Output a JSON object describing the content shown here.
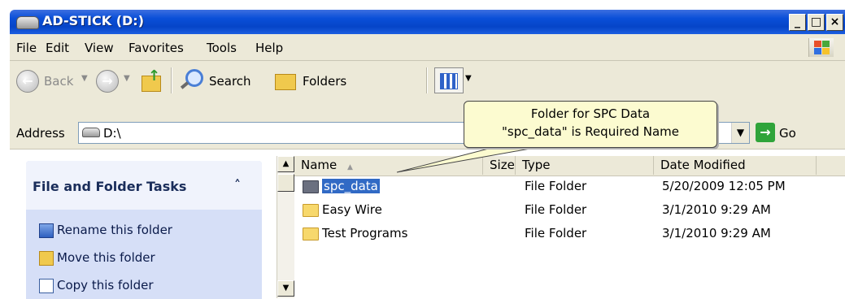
{
  "window": {
    "title": "AD-STICK (D:)",
    "controls": {
      "minimize": "_",
      "maximize": "□",
      "close": "×"
    }
  },
  "menubar": {
    "items": [
      "File",
      "Edit",
      "View",
      "Favorites",
      "Tools",
      "Help"
    ]
  },
  "toolbar": {
    "back_label": "Back",
    "search_label": "Search",
    "folders_label": "Folders"
  },
  "address": {
    "label": "Address",
    "value": "D:\\",
    "go_label": "Go"
  },
  "tasks_panel": {
    "title": "File and Folder Tasks",
    "collapse_glyph": "˄",
    "items": [
      {
        "label": "Rename this folder",
        "icon": "rename-icon"
      },
      {
        "label": "Move this folder",
        "icon": "move-icon"
      },
      {
        "label": "Copy this folder",
        "icon": "copy-icon"
      }
    ]
  },
  "file_list": {
    "columns": [
      "Name",
      "Size",
      "Type",
      "Date Modified"
    ],
    "rows": [
      {
        "name": "spc_data",
        "type": "File Folder",
        "date": "5/20/2009 12:05 PM",
        "selected": true
      },
      {
        "name": "Easy Wire",
        "type": "File Folder",
        "date": "3/1/2010 9:29 AM",
        "selected": false
      },
      {
        "name": "Test Programs",
        "type": "File Folder",
        "date": "3/1/2010 9:29 AM",
        "selected": false
      }
    ]
  },
  "callout": {
    "line1": "Folder for SPC Data",
    "line2": "\"spc_data\" is Required Name"
  },
  "colors": {
    "titlebar": "#0a4fd8",
    "chrome": "#ece9d8",
    "selection": "#316ac5",
    "tasks_panel": "#d6dff7",
    "callout_bg": "#fcfbd0"
  }
}
